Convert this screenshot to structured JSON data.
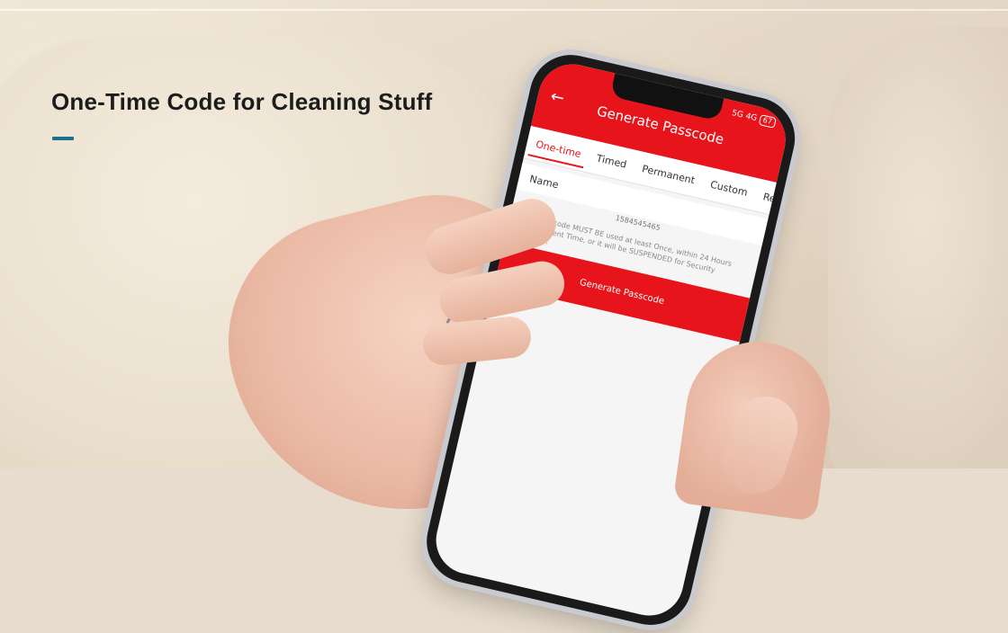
{
  "headline": "One-Time Code for Cleaning Stuff",
  "accent_color": "#1e6f8f",
  "phone": {
    "status": {
      "signal_left": "5G",
      "signal_right": "4G",
      "battery": "67"
    },
    "app_bar": {
      "back_icon": "arrow-left-icon",
      "title": "Generate Passcode",
      "color": "#e8141b"
    },
    "tabs": [
      "One-time",
      "Timed",
      "Permanent",
      "Custom",
      "Recur"
    ],
    "active_tab": "One-time",
    "name_label": "Name",
    "code_value": "1584545465",
    "notice": "This Passcode MUST BE used at least Once, within 24 Hours from Current Time, or it will be SUSPENDED for Security Reasons.",
    "button_label": "Generate Passcode"
  }
}
